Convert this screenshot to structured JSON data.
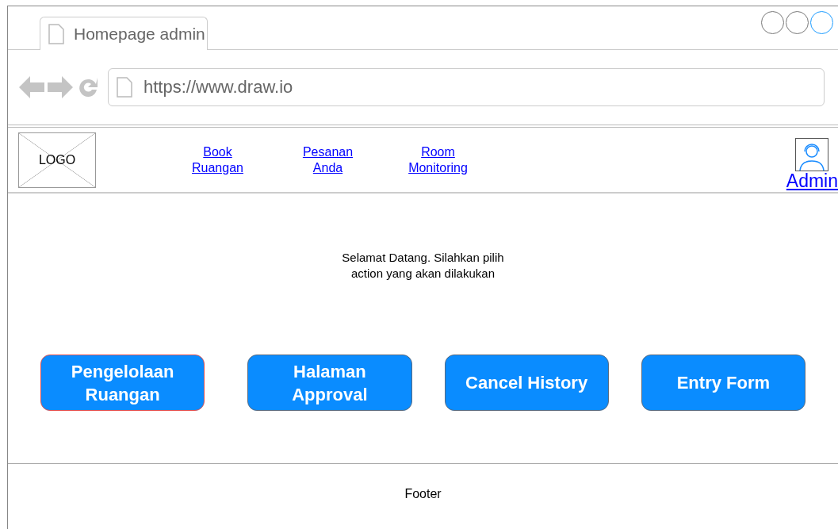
{
  "browser": {
    "tab_title": "Homepage admin",
    "url": "https://www.draw.io"
  },
  "nav": {
    "logo": "LOGO",
    "links": [
      {
        "line1": "Book",
        "line2": "Ruangan"
      },
      {
        "line1": "Pesanan",
        "line2": "Anda"
      },
      {
        "line1": "Room",
        "line2": "Monitoring"
      }
    ],
    "user": "Admin"
  },
  "welcome": {
    "line1": "Selamat Datang. Silahkan pilih",
    "line2": "action yang akan dilakukan"
  },
  "actions": [
    {
      "line1": "Pengelolaan",
      "line2": "Ruangan",
      "selected": true
    },
    {
      "line1": "Halaman",
      "line2": "Approval",
      "selected": false
    },
    {
      "line1": "Cancel History",
      "selected": false
    },
    {
      "line1": "Entry Form",
      "selected": false
    }
  ],
  "footer": "Footer"
}
